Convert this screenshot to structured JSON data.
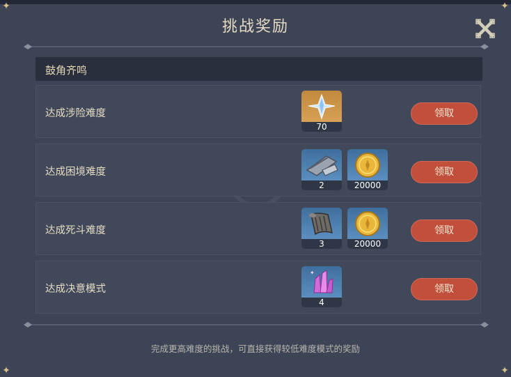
{
  "dialog": {
    "title": "挑战奖励",
    "section_title": "鼓角齐鸣",
    "footer_note": "完成更高难度的挑战，可直接获得较低难度模式的奖励"
  },
  "rows": [
    {
      "label": "达成涉险难度",
      "button": "领取",
      "rewards": [
        {
          "icon": "primogem-icon",
          "count": "70",
          "rarity_color": "#c1893e"
        }
      ]
    },
    {
      "label": "达成困境难度",
      "button": "领取",
      "rewards": [
        {
          "icon": "hero-wit-book-icon",
          "count": "2",
          "rarity_color": "#3f6f9c"
        },
        {
          "icon": "mora-coin-icon",
          "count": "20000",
          "rarity_color": "#3f6f9c"
        }
      ]
    },
    {
      "label": "达成死斗难度",
      "button": "领取",
      "rewards": [
        {
          "icon": "scroll-material-icon",
          "count": "3",
          "rarity_color": "#3f6f9c"
        },
        {
          "icon": "mora-coin-icon",
          "count": "20000",
          "rarity_color": "#3f6f9c"
        }
      ]
    },
    {
      "label": "达成决意模式",
      "button": "领取",
      "rewards": [
        {
          "icon": "crystal-cluster-icon",
          "count": "4",
          "rarity_color": "#3f6f9c"
        }
      ]
    }
  ],
  "colors": {
    "panel": "#3d4456",
    "row": "#404859",
    "header": "#2a2f3d",
    "claim_button": "#c24f3c",
    "title_text": "#e6dcc4"
  }
}
